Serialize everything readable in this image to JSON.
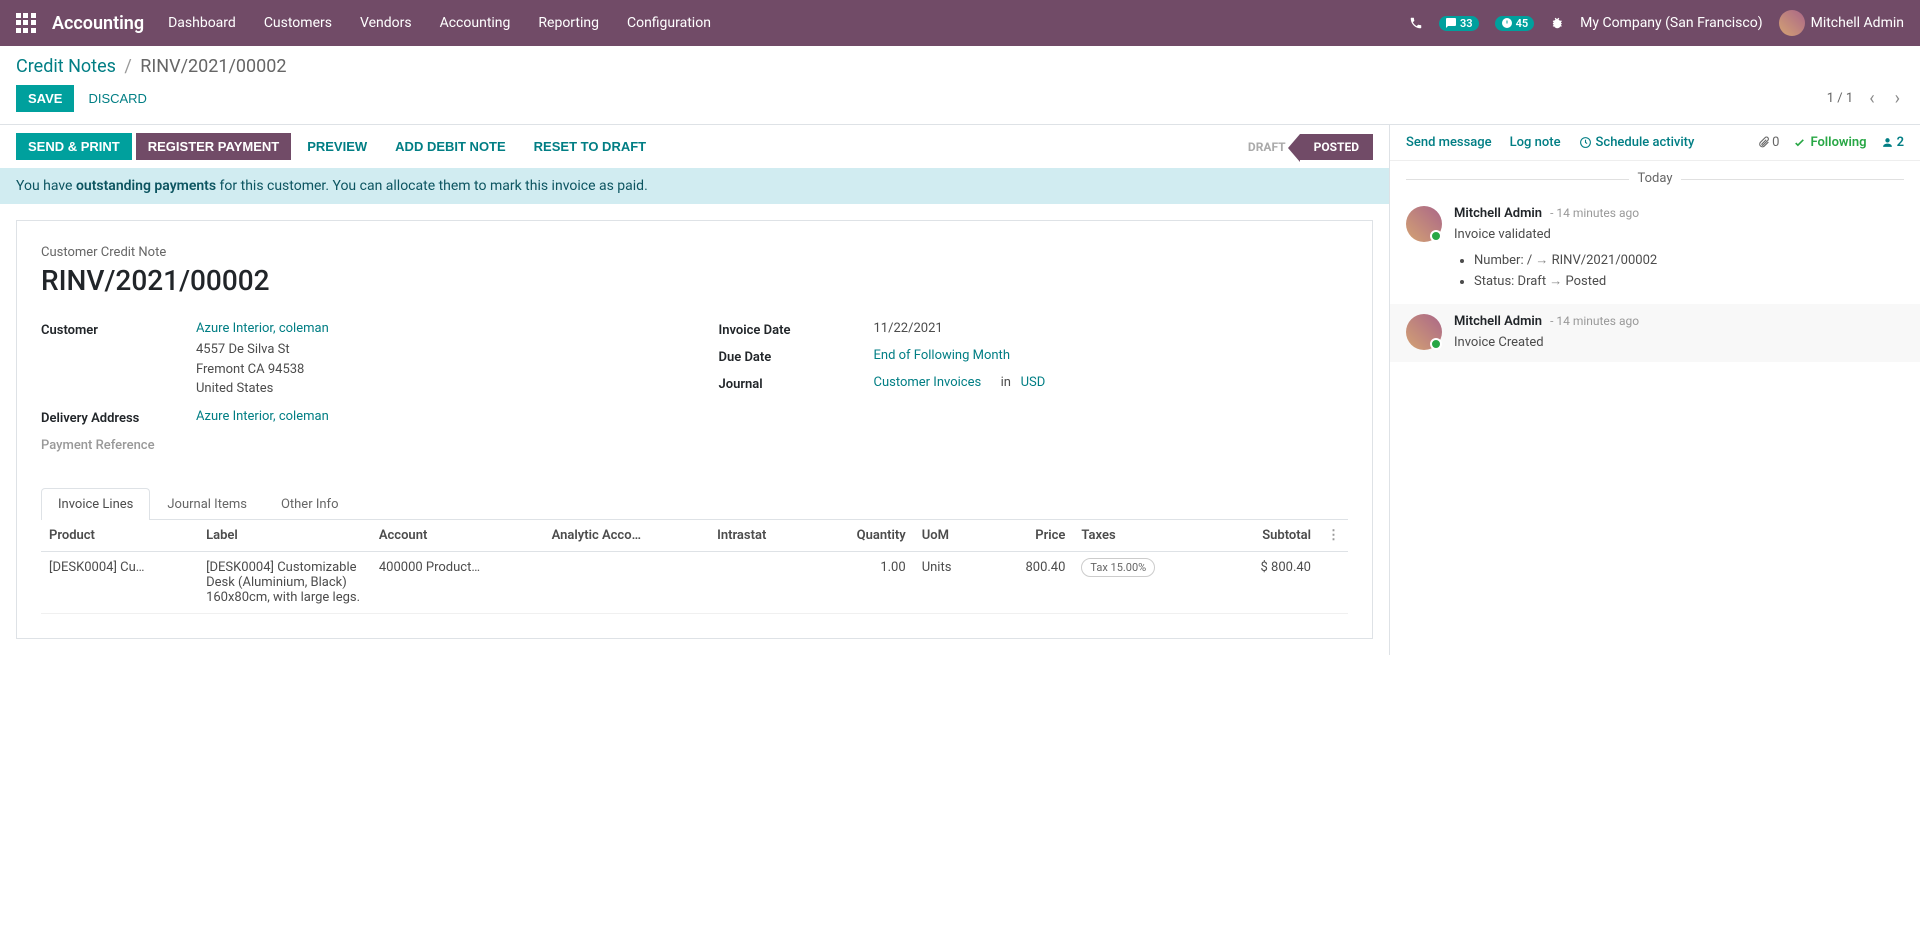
{
  "topnav": {
    "brand": "Accounting",
    "menu": [
      "Dashboard",
      "Customers",
      "Vendors",
      "Accounting",
      "Reporting",
      "Configuration"
    ],
    "msg_badge": "33",
    "activity_badge": "45",
    "company": "My Company (San Francisco)",
    "user": "Mitchell Admin"
  },
  "breadcrumb": {
    "parent": "Credit Notes",
    "current": "RINV/2021/00002"
  },
  "actions": {
    "save": "SAVE",
    "discard": "DISCARD",
    "pager": "1 / 1"
  },
  "btnbar": {
    "send_print": "SEND & PRINT",
    "register_payment": "REGISTER PAYMENT",
    "preview": "PREVIEW",
    "add_debit": "ADD DEBIT NOTE",
    "reset": "RESET TO DRAFT",
    "status_draft": "DRAFT",
    "status_posted": "POSTED"
  },
  "alert": {
    "pre": "You have ",
    "bold": "outstanding payments",
    "post": " for this customer. You can allocate them to mark this invoice as paid."
  },
  "form": {
    "title_label": "Customer Credit Note",
    "doc_name": "RINV/2021/00002",
    "customer_label": "Customer",
    "customer_link": "Azure Interior, coleman",
    "addr1": "4557 De Silva St",
    "addr2": "Fremont CA 94538",
    "addr3": "United States",
    "delivery_label": "Delivery Address",
    "delivery_link": "Azure Interior, coleman",
    "payment_ref_label": "Payment Reference",
    "invoice_date_label": "Invoice Date",
    "invoice_date": "11/22/2021",
    "due_date_label": "Due Date",
    "due_date": "End of Following Month",
    "journal_label": "Journal",
    "journal": "Customer Invoices",
    "journal_in": "in",
    "currency": "USD"
  },
  "tabs": {
    "invoice_lines": "Invoice Lines",
    "journal_items": "Journal Items",
    "other_info": "Other Info"
  },
  "table": {
    "headers": {
      "product": "Product",
      "label": "Label",
      "account": "Account",
      "analytic": "Analytic Acco…",
      "intrastat": "Intrastat",
      "quantity": "Quantity",
      "uom": "UoM",
      "price": "Price",
      "taxes": "Taxes",
      "subtotal": "Subtotal"
    },
    "row": {
      "product": "[DESK0004] Cu…",
      "label1": "[DESK0004] Customizable Desk (Aluminium, Black)",
      "label2": "160x80cm, with large legs.",
      "account": "400000 Product…",
      "quantity": "1.00",
      "uom": "Units",
      "price": "800.40",
      "tax": "Tax 15.00%",
      "subtotal": "$ 800.40"
    }
  },
  "chatter": {
    "send_message": "Send message",
    "log_note": "Log note",
    "schedule": "Schedule activity",
    "attach_count": "0",
    "following": "Following",
    "followers": "2",
    "today": "Today",
    "msg1": {
      "author": "Mitchell Admin",
      "time": "- 14 minutes ago",
      "body": "Invoice validated",
      "li1_pre": "Number: / ",
      "li1_post": " RINV/2021/00002",
      "li2_pre": "Status: Draft ",
      "li2_post": " Posted"
    },
    "msg2": {
      "author": "Mitchell Admin",
      "time": "- 14 minutes ago",
      "body": "Invoice Created"
    }
  }
}
